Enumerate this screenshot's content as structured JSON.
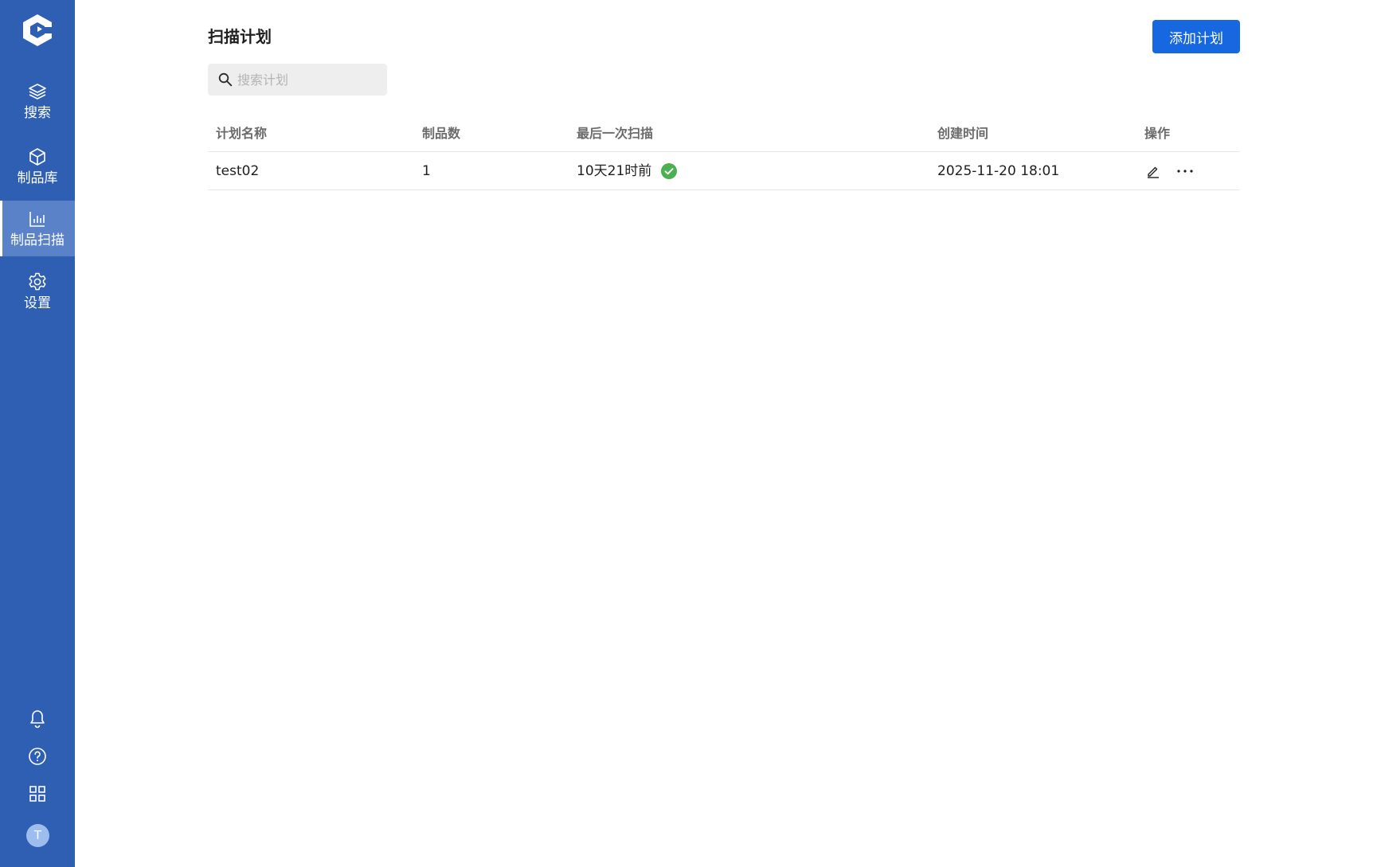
{
  "sidebar": {
    "logo_icon": "app-logo-icon",
    "items": [
      {
        "label": "搜索",
        "icon": "layers-icon",
        "active": false
      },
      {
        "label": "制品库",
        "icon": "cube-icon",
        "active": false
      },
      {
        "label": "制品扫描",
        "icon": "bar-chart-icon",
        "active": true
      },
      {
        "label": "设置",
        "icon": "gear-icon",
        "active": false
      }
    ],
    "utilities": {
      "bell_icon": "bell-icon",
      "help_icon": "help-circle-icon",
      "apps_icon": "grid-icon"
    },
    "avatar_initial": "T",
    "colors": {
      "background": "#2f5fb3",
      "active_background": "#5a82c9"
    }
  },
  "header": {
    "title": "扫描计划",
    "add_button_label": "添加计划",
    "accent_color": "#1768e0"
  },
  "search": {
    "placeholder": "搜索计划",
    "value": ""
  },
  "table": {
    "columns": [
      "计划名称",
      "制品数",
      "最后一次扫描",
      "创建时间",
      "操作"
    ],
    "rows": [
      {
        "name": "test02",
        "artifact_count": "1",
        "last_scan": "10天21时前",
        "last_scan_status": "success",
        "created_at": "2025-11-20 18:01"
      }
    ],
    "status_color": "#4caf50"
  }
}
